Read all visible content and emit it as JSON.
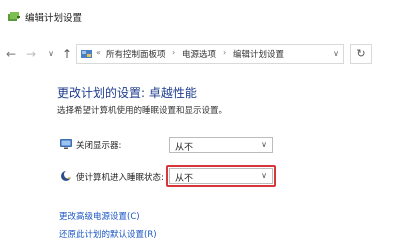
{
  "window": {
    "title": "编辑计划设置",
    "icon": "power-options-icon"
  },
  "nav": {
    "back_icon": "←",
    "forward_icon": "→",
    "dropdown_icon": "∨",
    "up_icon": "↑",
    "refresh_icon": "↻"
  },
  "breadcrumb": {
    "prefix": "«",
    "items": [
      "所有控制面板项",
      "电源选项",
      "编辑计划设置"
    ],
    "separator": "›",
    "dropdown_icon": "∨"
  },
  "main": {
    "heading": "更改计划的设置: 卓越性能",
    "subheading": "选择希望计算机使用的睡眠设置和显示设置。",
    "settings": [
      {
        "label": "关闭显示器:",
        "icon": "monitor-icon",
        "value": "从不"
      },
      {
        "label": "使计算机进入睡眠状态:",
        "icon": "sleep-moon-icon",
        "value": "从不"
      }
    ],
    "links": [
      "更改高级电源设置(C)",
      "还原此计划的默认设置(R)"
    ]
  },
  "colors": {
    "heading": "#1e3d8f",
    "link": "#1a56c4",
    "highlight": "#d8363a"
  }
}
